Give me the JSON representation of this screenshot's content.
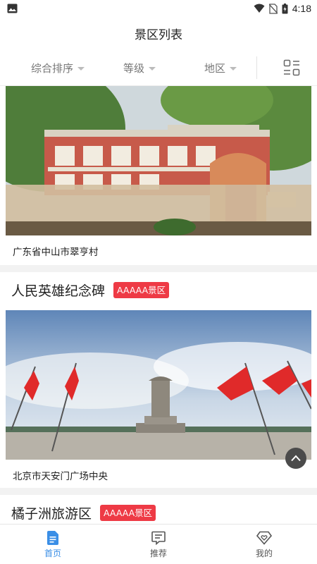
{
  "status_bar": {
    "time": "4:18"
  },
  "header": {
    "title": "景区列表"
  },
  "filters": {
    "sort_label": "综合排序",
    "grade_label": "等级",
    "region_label": "地区"
  },
  "cards": [
    {
      "name": "",
      "badge": "",
      "address": "广东省中山市翠亨村"
    },
    {
      "name": "人民英雄纪念碑",
      "badge": "AAAAA景区",
      "address": "北京市天安门广场中央"
    },
    {
      "name": "橘子洲旅游区",
      "badge": "AAAAA景区",
      "address": ""
    }
  ],
  "bottom_nav": {
    "items": [
      {
        "label": "首页",
        "icon": "home-doc-icon",
        "active": true
      },
      {
        "label": "推荐",
        "icon": "message-icon",
        "active": false
      },
      {
        "label": "我的",
        "icon": "diamond-heart-icon",
        "active": false
      }
    ]
  },
  "colors": {
    "accent": "#3a8ee6",
    "badge": "#ee3a45",
    "divider": "#f2f2f2"
  }
}
